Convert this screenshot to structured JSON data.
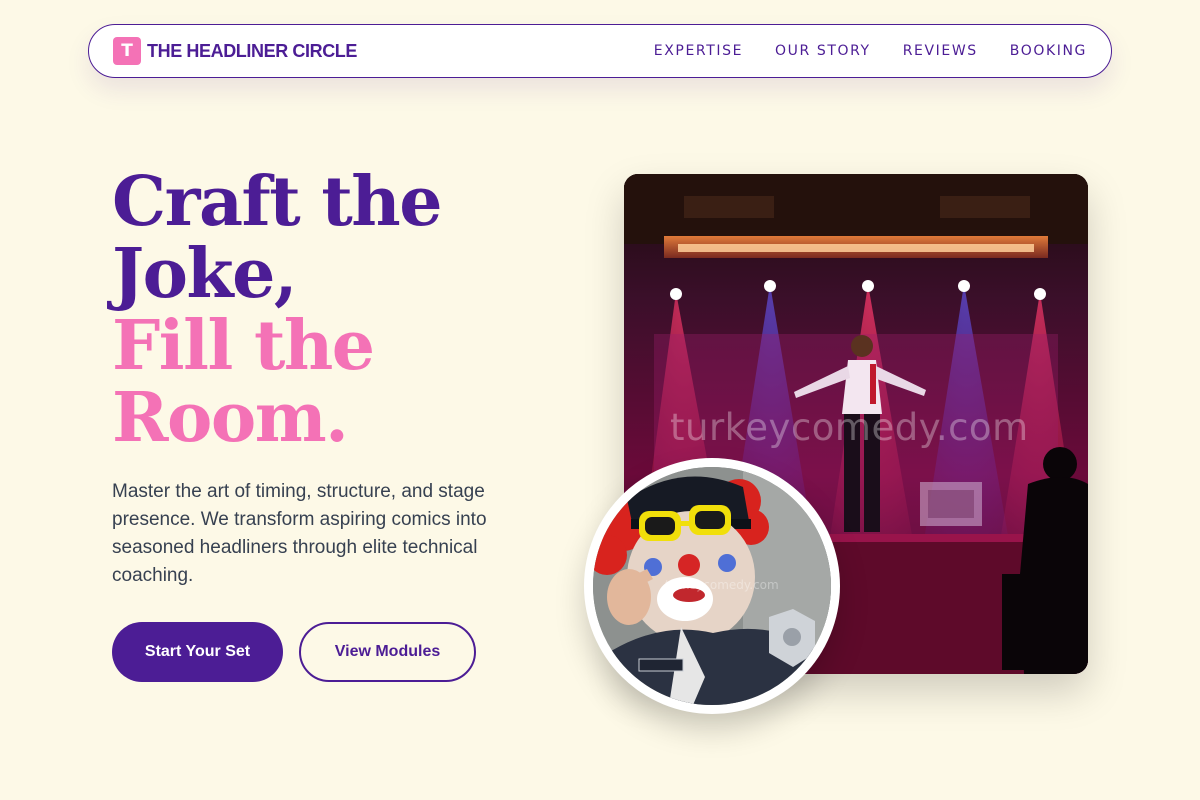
{
  "brand": {
    "mark": "T",
    "name": "THE HEADLINER CIRCLE"
  },
  "nav": {
    "items": [
      {
        "label": "EXPERTISE"
      },
      {
        "label": "OUR STORY"
      },
      {
        "label": "REVIEWS"
      },
      {
        "label": "BOOKING"
      }
    ]
  },
  "hero": {
    "headline_lines": [
      "Craft the",
      "Joke,",
      "Fill the",
      "Room."
    ],
    "description": "Master the art of timing, structure, and stage presence. We transform aspiring comics into seasoned headliners through elite technical coaching.",
    "primary_cta": "Start Your Set",
    "secondary_cta": "View Modules"
  },
  "images": {
    "stage_watermark": "turkeycomedy.com",
    "avatar_watermark": "turkeycomedy.com"
  },
  "colors": {
    "background": "#fdf9e7",
    "primary": "#4c1d95",
    "accent": "#f472b6",
    "body_text": "#374151"
  }
}
